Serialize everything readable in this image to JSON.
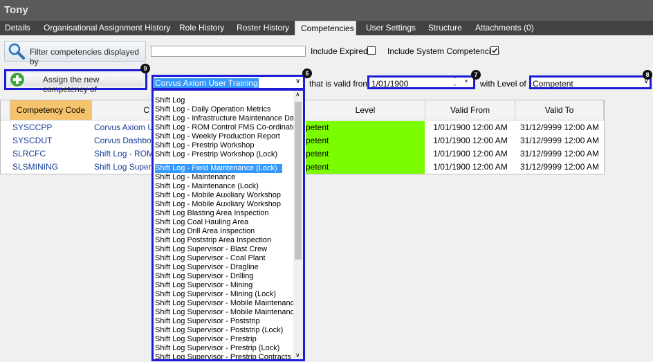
{
  "window": {
    "title": "Tony"
  },
  "tabs": [
    {
      "label": "Details",
      "active": false
    },
    {
      "label": "Organisational Assignment History",
      "active": false
    },
    {
      "label": "Role History",
      "active": false
    },
    {
      "label": "Roster History",
      "active": false
    },
    {
      "label": "Competencies",
      "active": true
    },
    {
      "label": "User Settings",
      "active": false
    },
    {
      "label": "Structure",
      "active": false
    },
    {
      "label": "Attachments (0)",
      "active": false
    }
  ],
  "filter": {
    "button_label": "Filter competencies displayed by",
    "text_value": "",
    "include_expired_label": "Include Expired",
    "include_expired_checked": false,
    "include_system_label": "Include System Competencies",
    "include_system_checked": true
  },
  "assign": {
    "button_label": "Assign the new competency of",
    "competency_value": "Corvus Axiom User Training",
    "valid_from_label": "that is valid from",
    "valid_from_value": "1/01/1900",
    "level_label": "with Level of",
    "level_value": "Competent"
  },
  "badges": {
    "b9": "9",
    "b6": "6",
    "b7": "7",
    "b8": "8"
  },
  "grid": {
    "headers": [
      "Competency Code",
      "C",
      "Level",
      "Valid From",
      "Valid To"
    ],
    "rows": [
      {
        "code": "SYSCCPP",
        "name": "Corvus Axiom Us",
        "level": "petent",
        "from": "1/01/1900 12:00 AM",
        "to": "31/12/9999 12:00 AM"
      },
      {
        "code": "SYSCDUT",
        "name": "Corvus Dashboa",
        "level": "petent",
        "from": "1/01/1900 12:00 AM",
        "to": "31/12/9999 12:00 AM"
      },
      {
        "code": "SLRCFC",
        "name": "Shift Log - ROM",
        "level": "petent",
        "from": "1/01/1900 12:00 AM",
        "to": "31/12/9999 12:00 AM"
      },
      {
        "code": "SLSMINING",
        "name": "Shift Log Supervi",
        "level": "petent",
        "from": "1/01/1900 12:00 AM",
        "to": "31/12/9999 12:00 AM"
      }
    ]
  },
  "dropdown_items": [
    "Shift Log",
    "Shift Log - Daily Operation Metrics",
    "Shift Log - Infrastructure Maintenance Day",
    "Shift Log - ROM Control FMS Co-ordinator",
    "Shift Log - Weekly Production Report",
    "Shift Log  -  Prestrip Workshop",
    "Shift Log  -  Prestrip Workshop (Lock)",
    "Shift Log     - Field Maintenance (Lock)",
    "Shift Log   - Maintenance",
    "Shift Log   - Maintenance (Lock)",
    "Shift Log   - Mobile Auxiliary Workshop",
    "Shift Log   - Mobile Auxiliary Workshop",
    "Shift Log  Blasting Area Inspection",
    "Shift Log  Coal Hauling Area",
    "Shift Log  Drill Area Inspection",
    "Shift Log  Poststrip Area Inspection",
    "Shift Log Supervisor - Blast Crew",
    "Shift Log Supervisor - Coal Plant",
    "Shift Log Supervisor - Dragline",
    "Shift Log Supervisor - Drilling",
    "Shift Log Supervisor - Mining",
    "Shift Log Supervisor - Mining (Lock)",
    "Shift Log Supervisor - Mobile Maintenance",
    "Shift Log Supervisor - Mobile Maintenance",
    "Shift Log Supervisor - Poststrip",
    "Shift Log Supervisor - Poststrip (Lock)",
    "Shift Log Supervisor - Prestrip",
    "Shift Log Supervisor - Prestrip (Lock)",
    "Shift Log Supervisor - Prestrip Contracts"
  ],
  "dropdown_selected_index": 7,
  "colors": {
    "highlight": "#1c1cd6",
    "level_green": "#7cfc00",
    "code_header": "#f5c36b",
    "link_blue": "#173d96"
  }
}
